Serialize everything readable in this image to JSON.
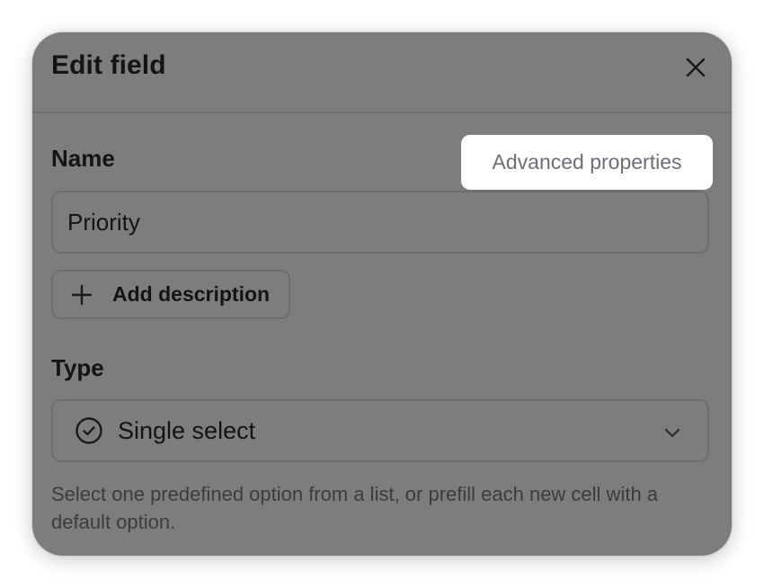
{
  "dialog": {
    "title": "Edit field",
    "close_icon": "close-icon"
  },
  "name_section": {
    "label": "Name",
    "advanced_properties_label": "Advanced properties",
    "input_value": "Priority",
    "add_description_label": "Add description",
    "add_icon": "plus-icon"
  },
  "type_section": {
    "label": "Type",
    "selected_value": "Single select",
    "selected_icon": "check-circle-icon",
    "dropdown_icon": "chevron-down-icon",
    "help_text": "Select one predefined option from a list, or prefill each new cell with a default option."
  },
  "colors": {
    "overlay": "#7d7d7d",
    "highlight": "#ffffff",
    "text": "#141414",
    "muted_text": "#6b6f76"
  }
}
